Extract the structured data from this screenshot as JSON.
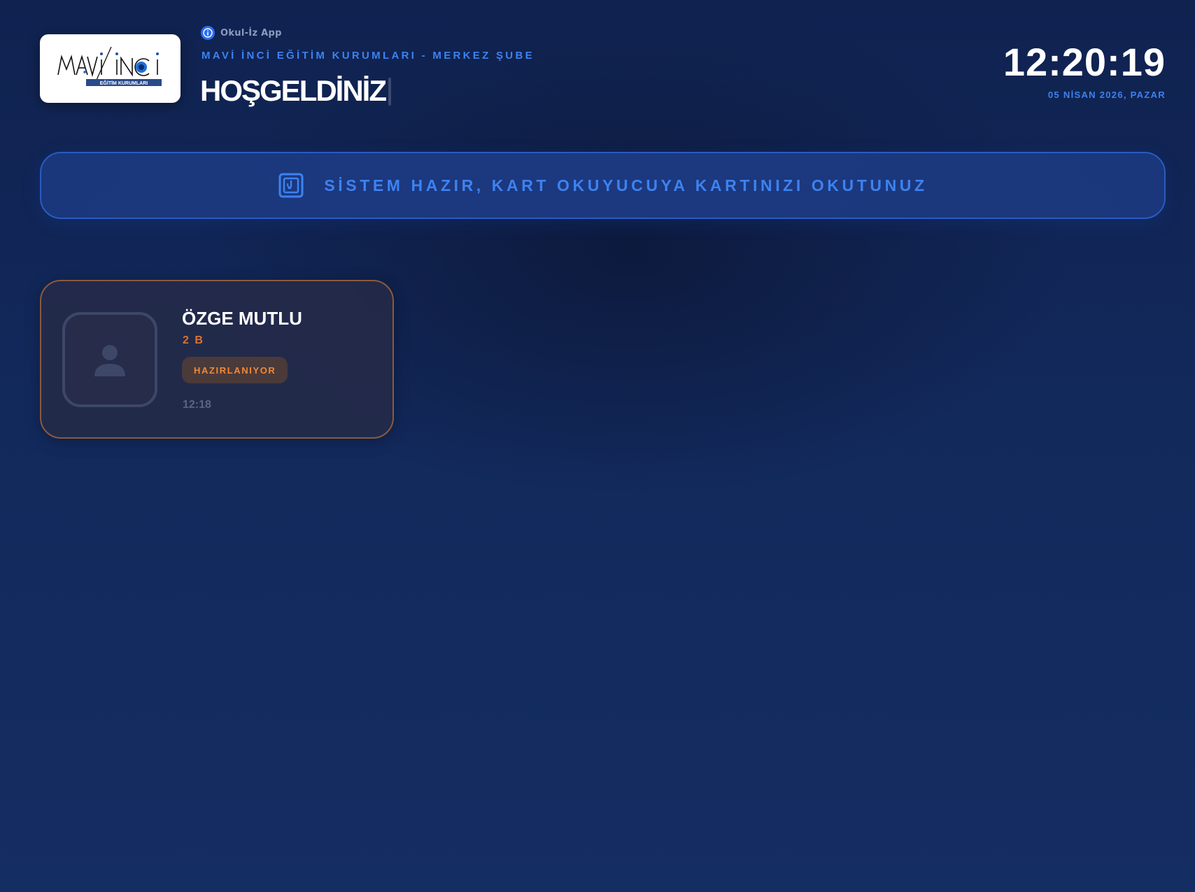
{
  "header": {
    "logo": {
      "brand_text": "MAVİ İNCİ",
      "ribbon_text": "EĞİTİM KURUMLARI"
    },
    "app_name": "Okul-İz App",
    "institution": "MAVİ İNCİ EĞİTİM KURUMLARI - MERKEZ ŞUBE",
    "welcome": "HOŞGELDİNİZ",
    "clock": "12:20:19",
    "date": "05 NİSAN 2026, PAZAR"
  },
  "status_banner": {
    "icon": "card-reader-icon",
    "text": "SİSTEM HAZIR, KART OKUYUCUYA KARTINIZI OKUTUNUZ"
  },
  "students": [
    {
      "name": "ÖZGE MUTLU",
      "class": "2 B",
      "status": "HAZIRLANIYOR",
      "time": "12:18",
      "avatar_icon": "user-placeholder-icon"
    }
  ],
  "colors": {
    "accent": "#3d82f0",
    "status_orange": "#f0893a",
    "class_orange": "#d9742f",
    "card_border": "#8a5a3e"
  }
}
